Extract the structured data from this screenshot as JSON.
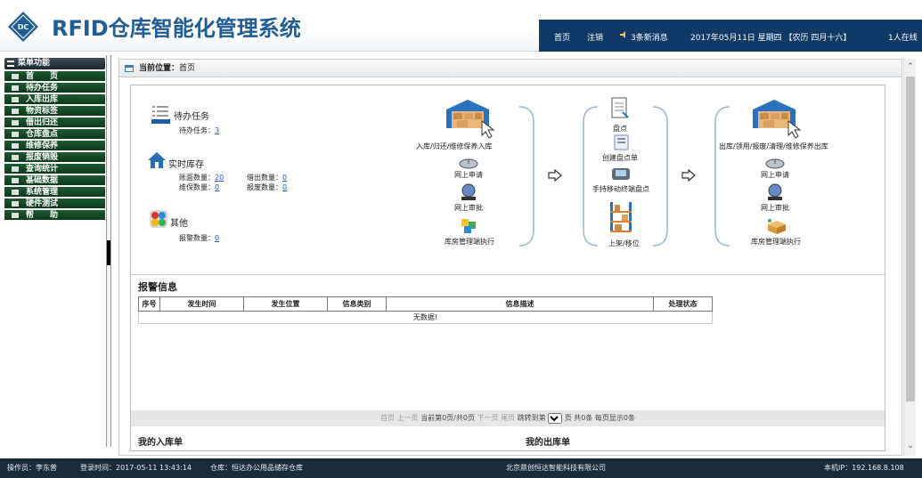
{
  "app": {
    "logo_text": "DC",
    "title": "RFID仓库智能化管理系统"
  },
  "topbar": {
    "home": "首页",
    "logout": "注销",
    "messages": "3条新消息",
    "datetime": "2017年05月11日 星期四 【农历 四月十六】",
    "online": "1人在线"
  },
  "sidebar": {
    "title": "菜单功能",
    "items": [
      "首　　页",
      "待办任务",
      "入库出库",
      "物资标签",
      "借出归还",
      "仓库盘点",
      "维修保养",
      "报废销毁",
      "查询统计",
      "基础数据",
      "系统管理",
      "硬件测试",
      "帮　　助"
    ]
  },
  "breadcrumb": {
    "prefix": "当前位置：",
    "page": "首页"
  },
  "summary": {
    "tasks": {
      "title": "待办任务",
      "label": "待办任务：",
      "count": "3"
    },
    "stock": {
      "title": "实时库存",
      "book_label": "账面数量：",
      "book": "20",
      "lend_label": "借出数量：",
      "lend": "0",
      "repair_label": "维保数量：",
      "repair": "0",
      "scrap_label": "报废数量：",
      "scrap": "0"
    },
    "other": {
      "title": "其他",
      "alarm_label": "报警数量：",
      "alarm": "0"
    }
  },
  "flow": {
    "inbound": "入库/归还/维修保养入库",
    "apply1": "网上申请",
    "approve1": "网上审批",
    "exec1": "库房管理端执行",
    "check": "盘点",
    "create_check": "创建盘点单",
    "handheld": "手持移动终端盘点",
    "shelve": "上架/移位",
    "outbound": "出库/领用/报废/清理/维修保养出库",
    "apply2": "网上申请",
    "approve2": "网上审批",
    "exec2": "库房管理端执行"
  },
  "alarm": {
    "title": "报警信息",
    "columns": [
      "序号",
      "发生时间",
      "发生位置",
      "信息类别",
      "信息描述",
      "处理状态"
    ],
    "empty": "无数据!"
  },
  "pager": {
    "first": "首页",
    "prev": "上一页",
    "current": "当前第0页/共0页",
    "next": "下一页",
    "last": "尾页",
    "jump": "跳转到第",
    "page_unit": "页",
    "total": "共0条 每页显示0条"
  },
  "sections": {
    "my_in": "我的入库单",
    "my_out": "我的出库单"
  },
  "status": {
    "operator": "操作员：李东普",
    "login": "登录时间：2017-05-11 13:43:14",
    "warehouse": "仓库：恒达办公用品储存仓库",
    "company": "北京鼎创恒达智能科技有限公司",
    "ip": "本机IP：192.168.8.108"
  },
  "colors": {
    "brand": "#1f5d92",
    "topbar": "#0f3a66",
    "menu": "#0d3a1c",
    "statusbar": "#1a2b3a",
    "link": "#1a55c7"
  },
  "icons": [
    "diamond-logo-icon",
    "speaker-icon",
    "menu-grid-icon",
    "page-icon",
    "task-list-icon",
    "house-icon",
    "other-icon",
    "warehouse-icon",
    "pointer-icon",
    "mouse-icon",
    "globe-icon",
    "cubes-icon",
    "clipboard-icon",
    "handheld-icon",
    "shelf-icon",
    "arrow-right-icon",
    "box-icon"
  ]
}
